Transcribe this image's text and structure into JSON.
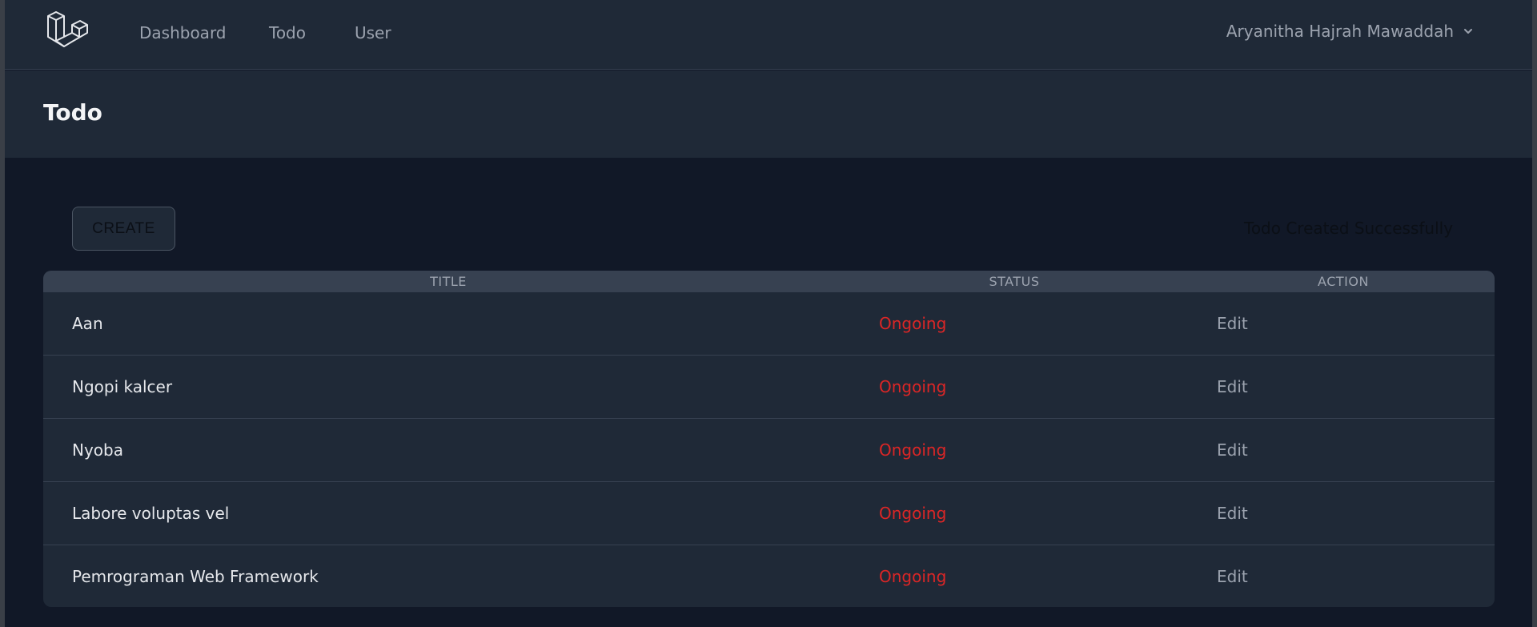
{
  "nav": {
    "links": [
      "Dashboard",
      "Todo",
      "User"
    ],
    "user_name": "Aryanitha Hajrah Mawaddah"
  },
  "header": {
    "title": "Todo"
  },
  "actions": {
    "create_label": "CREATE"
  },
  "flash": {
    "message": "Todo Created Successfully"
  },
  "table": {
    "columns": [
      "TITLE",
      "STATUS",
      "ACTION"
    ],
    "rows": [
      {
        "title": "Aan",
        "status": "Ongoing",
        "action": "Edit"
      },
      {
        "title": "Ngopi kalcer",
        "status": "Ongoing",
        "action": "Edit"
      },
      {
        "title": "Nyoba",
        "status": "Ongoing",
        "action": "Edit"
      },
      {
        "title": "Labore voluptas vel",
        "status": "Ongoing",
        "action": "Edit"
      },
      {
        "title": "Pemrograman Web Framework",
        "status": "Ongoing",
        "action": "Edit"
      }
    ]
  },
  "colors": {
    "background": "#111827",
    "surface": "#1f2937",
    "status_ongoing": "#dc2626"
  }
}
